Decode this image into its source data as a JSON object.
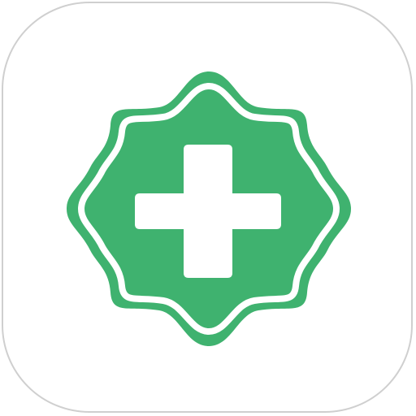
{
  "app_icon": {
    "icon": "medical-cross-badge-icon",
    "tile_background": "#ffffff",
    "tile_border_color": "#cfcfcf",
    "badge_color": "#3fb26f",
    "cross_color": "#ffffff"
  }
}
